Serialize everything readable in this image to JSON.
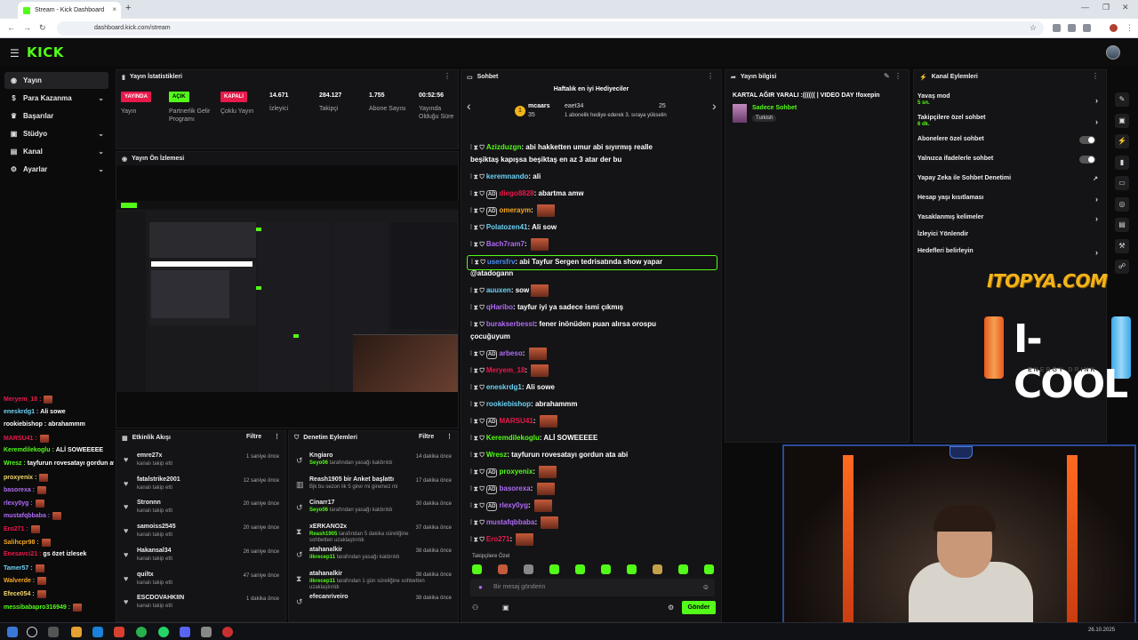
{
  "browser": {
    "tab_title": "Stream - Kick Dashboard",
    "tab_close": "×",
    "new_tab": "+",
    "url": "dashboard.kick.com/stream",
    "win_min": "—",
    "win_max": "❐",
    "win_close": "✕"
  },
  "brand": {
    "logo": "KICK",
    "accent": "#53fc18"
  },
  "sidebar": {
    "items": [
      {
        "label": "Yayın",
        "icon": "broadcast-icon"
      },
      {
        "label": "Para Kazanma",
        "icon": "money-icon"
      },
      {
        "label": "Başarılar",
        "icon": "trophy-icon"
      },
      {
        "label": "Stüdyo",
        "icon": "studio-icon"
      },
      {
        "label": "Kanal",
        "icon": "channel-icon"
      },
      {
        "label": "Ayarlar",
        "icon": "gear-icon"
      }
    ]
  },
  "stats": {
    "title": "Yayın İstatistikleri",
    "badges": [
      {
        "label": "YAYINDA",
        "caption": "Yayın",
        "color": "#e8194b"
      },
      {
        "label": "AÇIK",
        "caption": "Partnerlik Gelir Programı",
        "color": "#53fc18"
      },
      {
        "label": "KAPALI",
        "caption": "Çoklu Yayın",
        "color": "#e8194b"
      }
    ],
    "numbers": [
      {
        "value": "14.671",
        "caption": "İzleyici"
      },
      {
        "value": "284.127",
        "caption": "Takipçi"
      },
      {
        "value": "1.755",
        "caption": "Abone Sayısı"
      },
      {
        "value": "00:52:56",
        "caption": "Yayında Olduğu Süre"
      }
    ]
  },
  "preview": {
    "title": "Yayın Ön İzlemesi"
  },
  "left_chat": [
    {
      "user": "Meryem_18 :",
      "msg": "",
      "color": "#e8194b",
      "emote": true
    },
    {
      "user": "eneskrdg1 :",
      "msg": "Ali sowe",
      "color": "#6bd1f5",
      "emote": false
    },
    {
      "user": "rookiebishop :",
      "msg": "abrahammm",
      "color": "#ffffff",
      "emote": false
    },
    {
      "user": "MARSU41 :",
      "msg": "",
      "color": "#e8194b",
      "emote": true
    },
    {
      "user": "Keremdilekoglu :",
      "msg": "ALİ SOWEEEEE",
      "color": "#53fc18",
      "emote": false
    },
    {
      "user": "Wresz :",
      "msg": "tayfurun rovesatayı gordun ata abi",
      "color": "#53fc18",
      "emote": false
    },
    {
      "user": "proxyenix :",
      "msg": "",
      "color": "#f5d76b",
      "emote": true
    },
    {
      "user": "basorexa :",
      "msg": "",
      "color": "#b06bf5",
      "emote": true
    },
    {
      "user": "rlexy0yg :",
      "msg": "",
      "color": "#b06bf5",
      "emote": true
    },
    {
      "user": "mustafqbbaba :",
      "msg": "",
      "color": "#b06bf5",
      "emote": true
    },
    {
      "user": "Ero271 :",
      "msg": "",
      "color": "#e8194b",
      "emote": true
    },
    {
      "user": "Salihcpr98 :",
      "msg": "",
      "color": "#f5a623",
      "emote": true
    },
    {
      "user": "Enesavci21 :",
      "msg": "gs özet izlesek",
      "color": "#e8194b",
      "emote": false
    },
    {
      "user": "Tamer57 :",
      "msg": "",
      "color": "#6bd1f5",
      "emote": true
    },
    {
      "user": "Walverde :",
      "msg": "",
      "color": "#f5a623",
      "emote": true
    },
    {
      "user": "Efece054 :",
      "msg": "",
      "color": "#f5d76b",
      "emote": true
    },
    {
      "user": "messibabapro316949 :",
      "msg": "",
      "color": "#53fc18",
      "emote": true
    }
  ],
  "activity": {
    "title": "Etkinlik Akışı",
    "filter": "Filtre",
    "rows": [
      {
        "name": "emre27x",
        "sub": "kanalı takip etti",
        "time": "1 saniye önce"
      },
      {
        "name": "fatalstrike2001",
        "sub": "kanalı takip etti",
        "time": "12 saniye önce"
      },
      {
        "name": "Stronnn",
        "sub": "kanalı takip etti",
        "time": "20 saniye önce"
      },
      {
        "name": "samoiss2545",
        "sub": "kanalı takip etti",
        "time": "20 saniye önce"
      },
      {
        "name": "Hakansal34",
        "sub": "kanalı takip etti",
        "time": "26 saniye önce"
      },
      {
        "name": "quiltx",
        "sub": "kanalı takip etti",
        "time": "47 saniye önce"
      },
      {
        "name": "ESCDOVAHKIIN",
        "sub": "kanalı takip etti",
        "time": "1 dakika önce"
      }
    ]
  },
  "moderation": {
    "title": "Denetim Eylemleri",
    "filter": "Filtre",
    "rows": [
      {
        "icon": "undo-icon",
        "name": "Kngiaro",
        "actor": "Seyo06",
        "sub": " tarafından yasağı kaldırıldı",
        "time": "14 dakika önce"
      },
      {
        "icon": "poll-icon",
        "name": "Reash1905 bir Anket başlattı",
        "actor": "",
        "sub": "Bjk bu sezon lik 5 girer mi giremez mi",
        "time": "17 dakika önce"
      },
      {
        "icon": "undo-icon",
        "name": "Cinarr17",
        "actor": "Seyo06",
        "sub": " tarafından yasağı kaldırıldı",
        "time": "30 dakika önce"
      },
      {
        "icon": "hourglass-icon",
        "name": "xERKANO2x",
        "actor": "Reash1905",
        "sub": " tarafından 5 dakika süreliğine sohbetten uzaklaştırıldı",
        "time": "37 dakika önce"
      },
      {
        "icon": "undo-icon",
        "name": "atahanalkir",
        "actor": "ilkrecep11",
        "sub": " tarafından yasağı kaldırıldı",
        "time": "38 dakika önce"
      },
      {
        "icon": "hourglass-icon",
        "name": "atahanalkir",
        "actor": "ilkrecep11",
        "sub": " tarafından 1 gün süreliğine sohbetten uzaklaştırıldı",
        "time": "38 dakika önce"
      },
      {
        "icon": "undo-icon",
        "name": "efecanriveiro",
        "actor": "",
        "sub": "",
        "time": "38 dakika önce"
      }
    ]
  },
  "chat": {
    "title": "Sohbet",
    "gift_title": "Haftalık en iyi Hediyeciler",
    "gift_first": "mcaars",
    "gift_first_count": "35",
    "gift_second": "eaet34",
    "gift_second_count": "25",
    "gift_note": "1 abonelik hediye ederek 3. sıraya yükselin",
    "prev": "‹",
    "next": "›",
    "messages": [
      {
        "user": "Azizduzgn",
        "color": "#53fc18",
        "text": "abi hakketten umur abi sıyırmış realle",
        "text2": "beşiktaş kapışsa beşiktaş en az 3 atar der bu",
        "emote": false,
        "vip": false
      },
      {
        "user": "keremnando",
        "color": "#6bd1f5",
        "text": "ali",
        "emote": false,
        "vip": false
      },
      {
        "user": "diego8828",
        "color": "#e8194b",
        "text": "abartma amw",
        "emote": false,
        "vip": true
      },
      {
        "user": "omeraym",
        "color": "#f5a623",
        "text": "",
        "emote": true,
        "vip": true
      },
      {
        "user": "Polatozen41",
        "color": "#6bd1f5",
        "text": "Ali sow",
        "emote": false,
        "vip": false
      },
      {
        "user": "Bach7ram7",
        "color": "#b06bf5",
        "text": "",
        "emote": true,
        "vip": false
      },
      {
        "user": "usersfrv",
        "color": "#4a8cf5",
        "text": "abi Tayfur Sergen tedrisatında show yapar",
        "text2": "@atadogann",
        "emote": false,
        "vip": false,
        "highlight": true
      },
      {
        "user": "auuxen",
        "color": "#6bd1f5",
        "text": "sow",
        "emote": true,
        "vip": false
      },
      {
        "user": "qHaribo",
        "color": "#b06bf5",
        "text": "tayfur iyi ya sadece ismi çıkmış",
        "emote": false,
        "vip": false
      },
      {
        "user": "burakserbesst",
        "color": "#b06bf5",
        "text": "fener inönüden puan alırsa orospu",
        "text2": "çocuğuyum",
        "emote": false,
        "vip": false
      },
      {
        "user": "arbeso",
        "color": "#b06bf5",
        "text": "",
        "emote": true,
        "vip": true
      },
      {
        "user": "Meryem_18",
        "color": "#e8194b",
        "text": "",
        "emote": true,
        "vip": false
      },
      {
        "user": "eneskrdg1",
        "color": "#6bd1f5",
        "text": "Ali sowe",
        "emote": false,
        "vip": false
      },
      {
        "user": "rookiebishop",
        "color": "#6bd1f5",
        "text": "abrahammm",
        "emote": false,
        "vip": false
      },
      {
        "user": "MARSU41",
        "color": "#e8194b",
        "text": "",
        "emote": true,
        "vip": true
      },
      {
        "user": "Keremdilekoglu",
        "color": "#53fc18",
        "text": "ALİ SOWEEEEE",
        "emote": false,
        "vip": false
      },
      {
        "user": "Wresz",
        "color": "#53fc18",
        "text": "tayfurun rovesatayı gordun ata abi",
        "emote": false,
        "vip": false
      },
      {
        "user": "proxyenix",
        "color": "#53fc18",
        "text": "",
        "emote": true,
        "vip": true
      },
      {
        "user": "basorexa",
        "color": "#b06bf5",
        "text": "",
        "emote": true,
        "vip": true
      },
      {
        "user": "rlexy0yg",
        "color": "#b06bf5",
        "text": "",
        "emote": true,
        "vip": true
      },
      {
        "user": "mustafqbbaba",
        "color": "#b06bf5",
        "text": "",
        "emote": true,
        "vip": false
      },
      {
        "user": "Ero271",
        "color": "#e8194b",
        "text": "",
        "emote": true,
        "vip": false
      }
    ],
    "followers_only": "Takipçilere Özel",
    "input_placeholder": "Bir mesaj gönderin",
    "send_label": "Gönder"
  },
  "stream_info": {
    "title": "Yayın bilgisi",
    "stream_title": "KARTAL AĞIR YARALI :(((((( | VIDEO DAY !foxepin",
    "category": "Sadece Sohbet",
    "tag": "Turkish"
  },
  "channel_actions": {
    "title": "Kanal Eylemleri",
    "items": [
      {
        "label": "Yavaş mod",
        "sub": "5 sn.",
        "control": "arrow"
      },
      {
        "label": "Takipçilere özel sohbet",
        "sub": "6 dk.",
        "control": "arrow"
      },
      {
        "label": "Abonelere özel sohbet",
        "sub": "",
        "control": "toggle"
      },
      {
        "label": "Yalnızca ifadelerle sohbet",
        "sub": "",
        "control": "toggle"
      },
      {
        "label": "Yapay Zeka ile Sohbet Denetimi",
        "sub": "",
        "control": "external"
      },
      {
        "label": "Hesap yaşı kısıtlaması",
        "sub": "",
        "control": "arrow"
      },
      {
        "label": "Yasaklanmış kelimeler",
        "sub": "",
        "control": "arrow"
      },
      {
        "label": "İzleyici Yönlendir",
        "sub": "",
        "control": "none"
      },
      {
        "label": "Hedefleri belirleyin",
        "sub": "",
        "control": "arrow"
      }
    ]
  },
  "overlay": {
    "sponsor1": "ITOPYA.COM",
    "sponsor2": "I-COOL",
    "sponsor2_sub": "ENERGY DRINK"
  },
  "taskbar": {
    "date": "26.10.2025"
  }
}
